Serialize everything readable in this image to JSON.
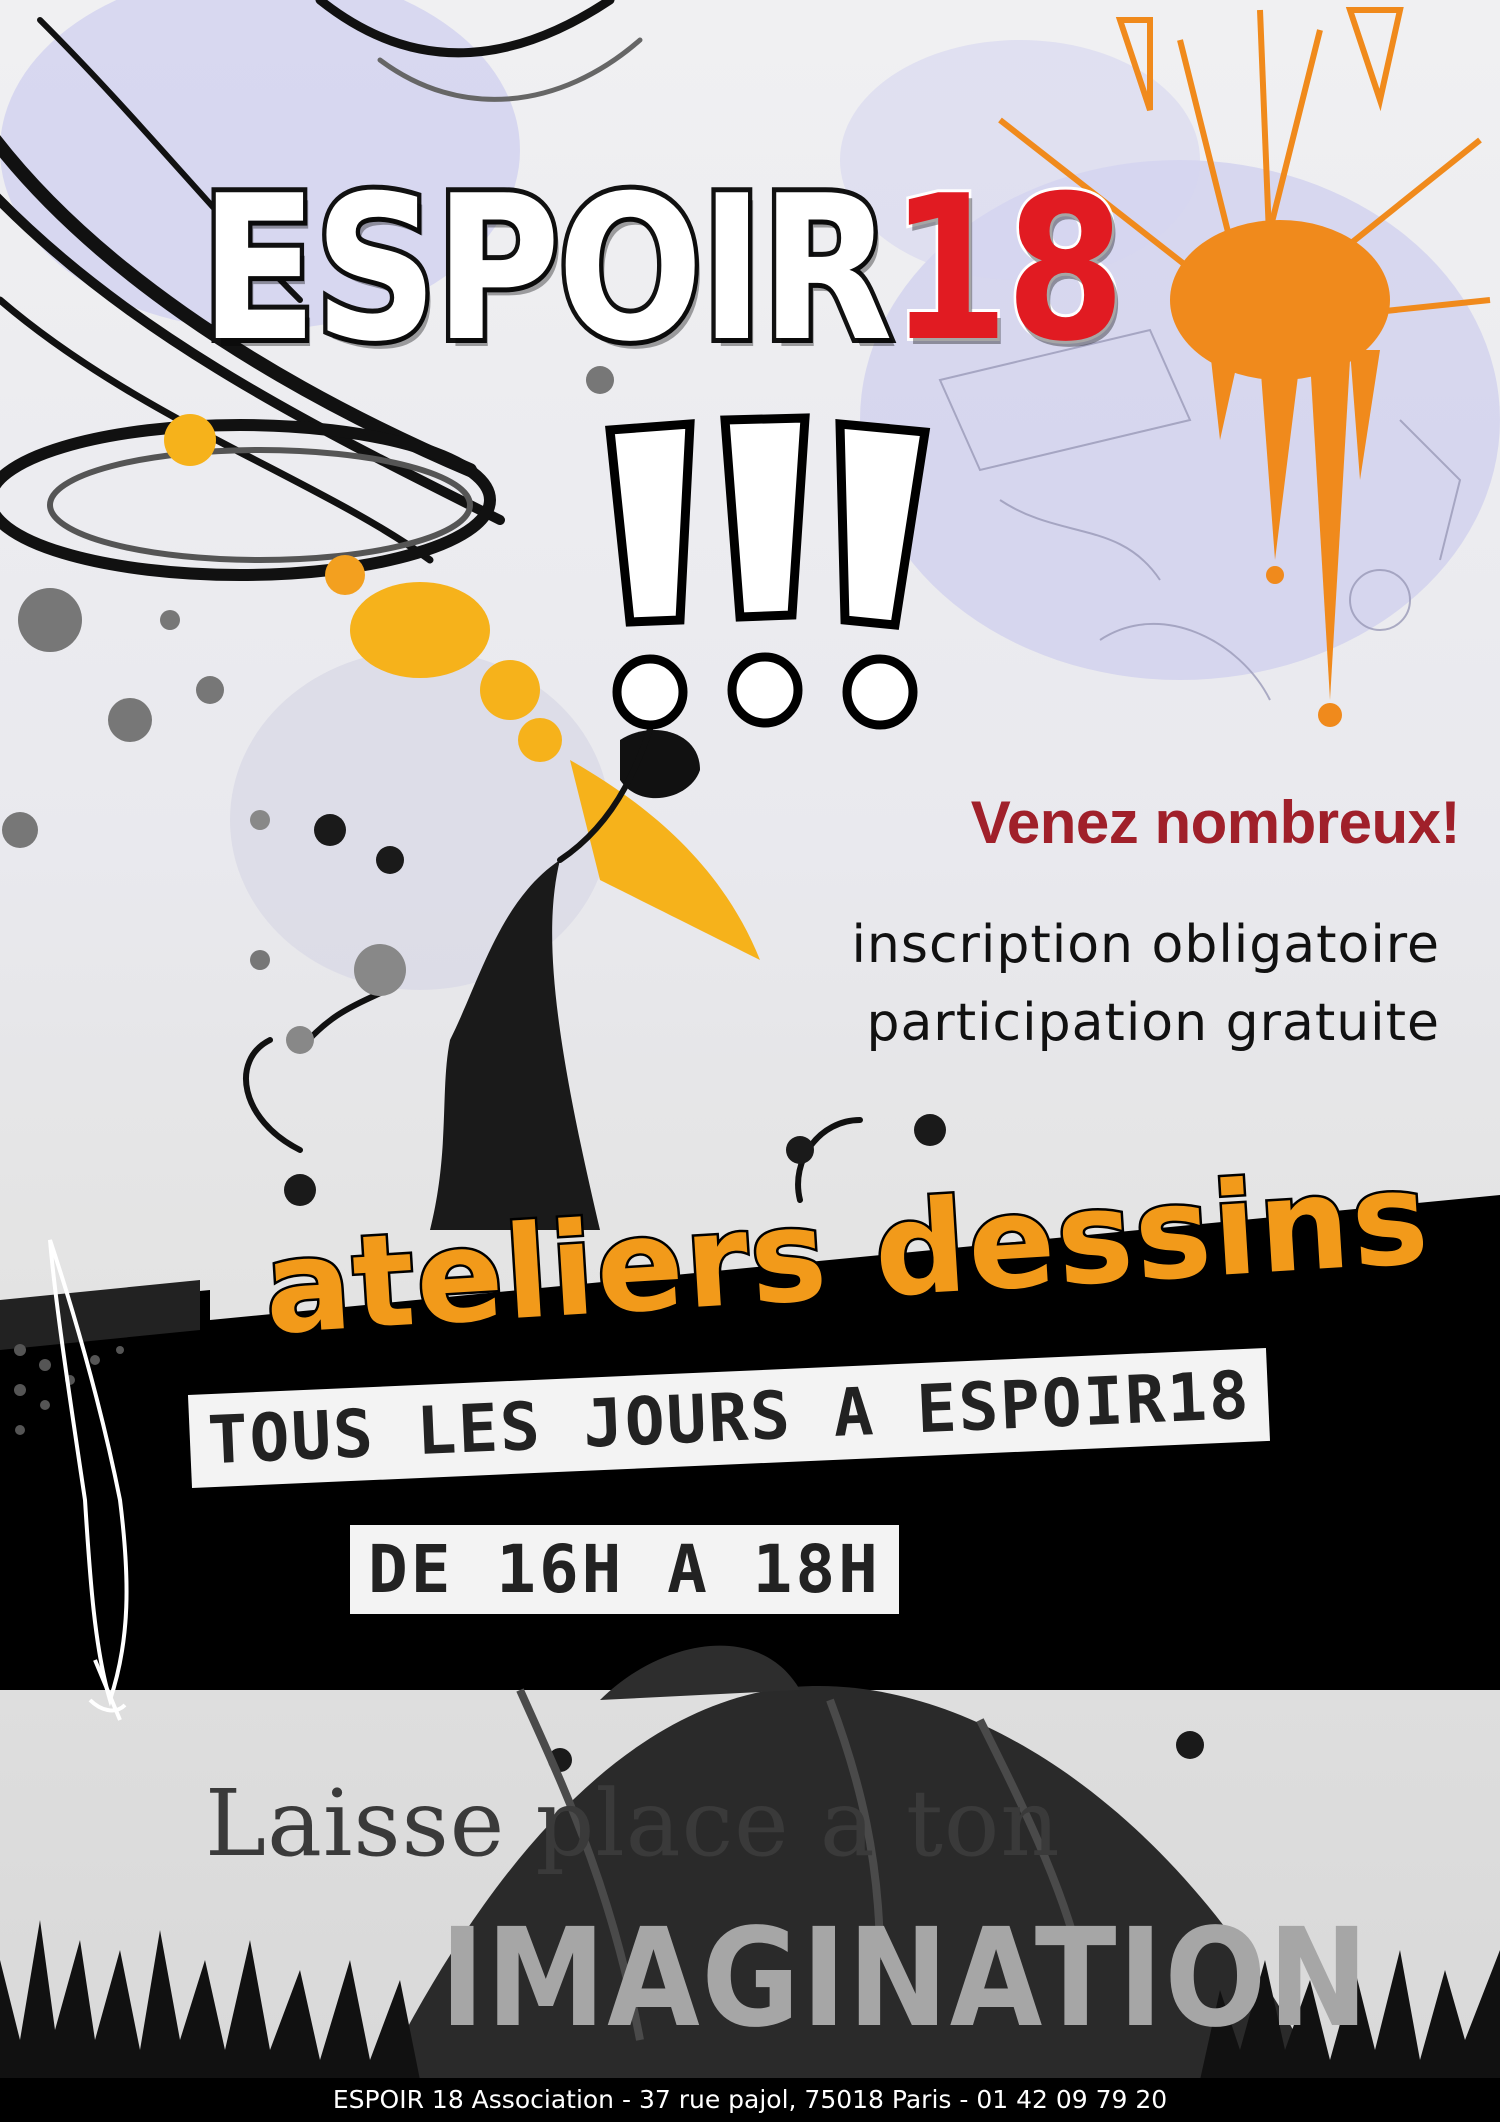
{
  "poster": {
    "title_main": "ESPOIR",
    "title_number": "18",
    "exclamation": "!!!",
    "call_to_action": "Venez nombreux!",
    "info_lines": [
      "inscription obligatoire",
      "participation gratuite"
    ],
    "activity": "ateliers dessins",
    "schedule_line_1": "TOUS LES JOURS A ESPOIR18",
    "schedule_line_2": "DE 16H A 18H",
    "tagline_1": "Laisse place a ton",
    "tagline_2": "IMAGINATION",
    "footer": "ESPOIR 18 Association - 37 rue pajol, 75018 Paris - 01 42 09 79 20"
  },
  "colors": {
    "title_red": "#e11b22",
    "cta_red": "#a0202a",
    "activity_orange": "#f29a1a",
    "splash_orange": "#f08a1c",
    "splash_yellow": "#f6b21b",
    "lavender_wash": "#c8c8ec",
    "band_black": "#000000"
  },
  "icons": [
    "paintbrush-icon",
    "flower-icon",
    "grass-icon",
    "splash-icon"
  ]
}
